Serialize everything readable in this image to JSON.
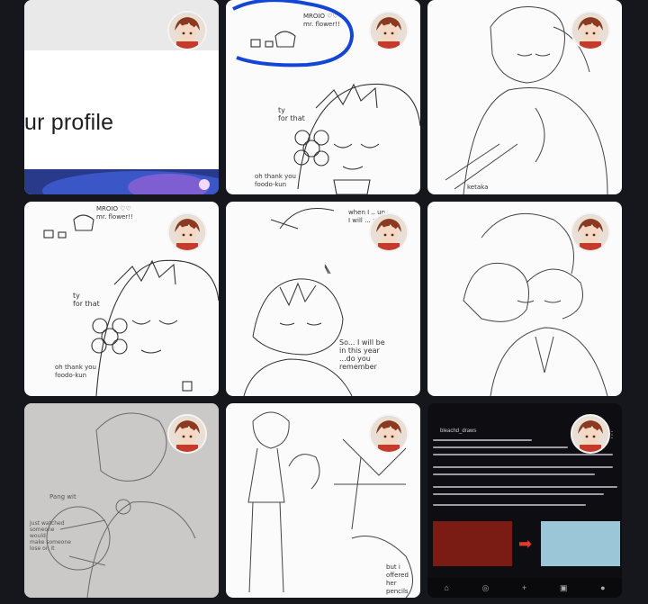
{
  "gallery": {
    "tiles": [
      {
        "caption": "ur profile"
      },
      {
        "handwriting": "ty\nfor that",
        "note": "oh thank you\nfoodo-kun",
        "sign": "MROIO ♡♡\nmr. flower!!"
      },
      {
        "signature": "ketaka"
      },
      {
        "handwriting": "ty\nfor that",
        "note": "oh thank you\nfoodo-kun",
        "sign": "MROIO ♡♡\nmr. flower!!"
      },
      {
        "handwriting": "So... I will be\nin this year\n...do you\nremember",
        "top": "when I .. up\nI will ... a"
      },
      {},
      {
        "handwriting": "Pang wit",
        "note": "Just watched\nsomeone\nwould\nmake someone\nlose on it"
      },
      {
        "handwriting": "but i\noffered\nher pencils"
      },
      {
        "post_author": "bleachd_draws",
        "nav": [
          "⌂",
          "◎",
          "+",
          "▣",
          "●"
        ]
      }
    ]
  },
  "colors": {
    "background": "#16171c",
    "circle_highlight": "#1446d6",
    "arrow": "#e23b2b"
  }
}
